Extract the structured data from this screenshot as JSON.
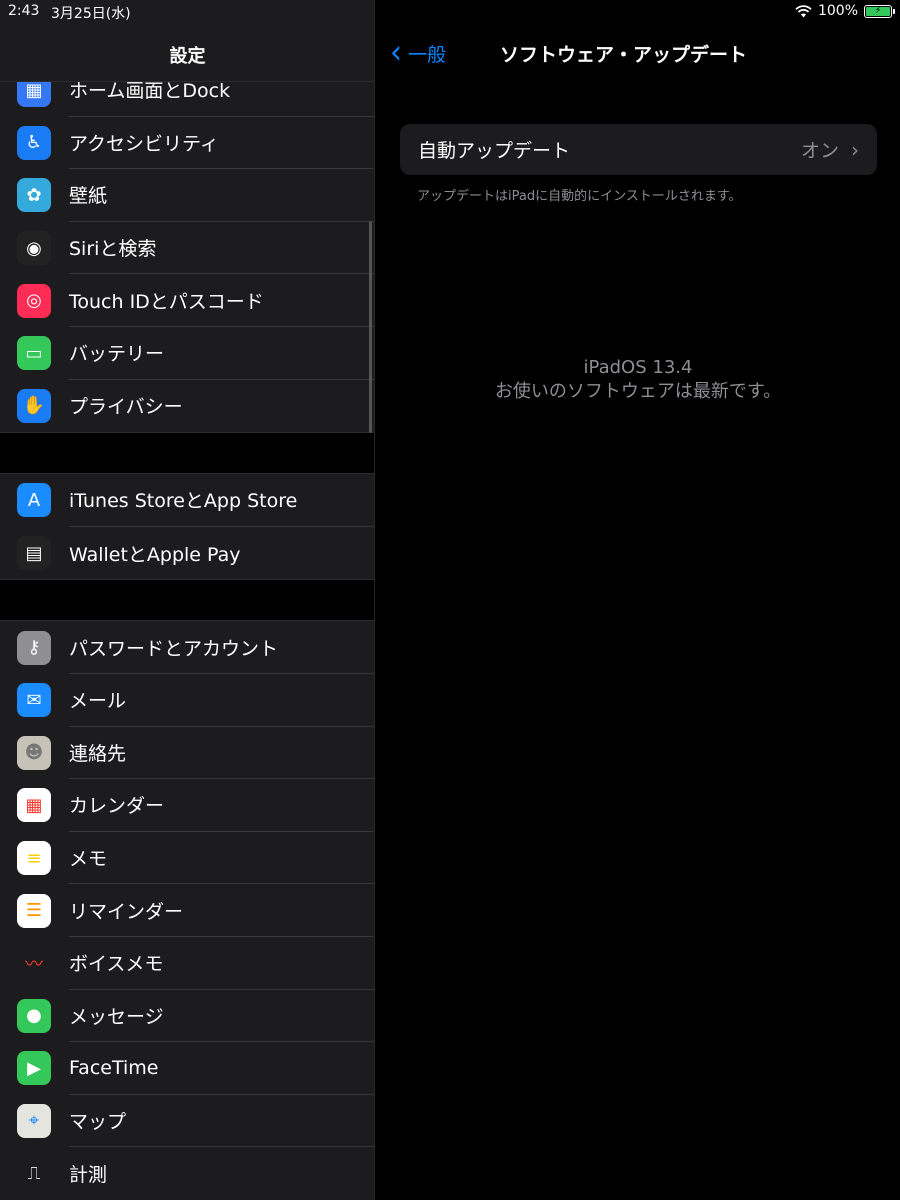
{
  "status": {
    "time": "2:43",
    "date": "3月25日(水)",
    "battery": "100%"
  },
  "sidebar": {
    "title": "設定",
    "groups": [
      [
        {
          "label": "ホーム画面とDock",
          "icon": "home-screen-icon",
          "color": "#3478f6"
        },
        {
          "label": "アクセシビリティ",
          "icon": "accessibility-icon",
          "color": "#1a7cf5"
        },
        {
          "label": "壁紙",
          "icon": "wallpaper-icon",
          "color": "#34aadc"
        },
        {
          "label": "Siriと検索",
          "icon": "siri-icon",
          "color": "#222"
        },
        {
          "label": "Touch IDとパスコード",
          "icon": "touch-id-icon",
          "color": "#ff2d55"
        },
        {
          "label": "バッテリー",
          "icon": "battery-icon",
          "color": "#34c759"
        },
        {
          "label": "プライバシー",
          "icon": "privacy-hand-icon",
          "color": "#1a7cf5"
        }
      ],
      [
        {
          "label": "iTunes StoreとApp Store",
          "icon": "app-store-icon",
          "color": "#1a8cff"
        },
        {
          "label": "WalletとApple Pay",
          "icon": "wallet-icon",
          "color": "#222"
        }
      ],
      [
        {
          "label": "パスワードとアカウント",
          "icon": "key-icon",
          "color": "#8e8e93"
        },
        {
          "label": "メール",
          "icon": "mail-icon",
          "color": "#1a8cff"
        },
        {
          "label": "連絡先",
          "icon": "contacts-icon",
          "color": "#c7c2b8"
        },
        {
          "label": "カレンダー",
          "icon": "calendar-icon",
          "color": "#ffffff"
        },
        {
          "label": "メモ",
          "icon": "notes-icon",
          "color": "#ffffff"
        },
        {
          "label": "リマインダー",
          "icon": "reminders-icon",
          "color": "#ffffff"
        },
        {
          "label": "ボイスメモ",
          "icon": "voice-memo-icon",
          "color": "#1c1c1e"
        },
        {
          "label": "メッセージ",
          "icon": "messages-icon",
          "color": "#34c759"
        },
        {
          "label": "FaceTime",
          "icon": "facetime-icon",
          "color": "#34c759"
        },
        {
          "label": "マップ",
          "icon": "maps-icon",
          "color": "#e5e5e0"
        },
        {
          "label": "計測",
          "icon": "measure-icon",
          "color": "#1c1c1e"
        }
      ]
    ]
  },
  "main": {
    "back_label": "一般",
    "title": "ソフトウェア・アップデート",
    "auto_update_label": "自動アップデート",
    "auto_update_value": "オン",
    "footnote": "アップデートはiPadに自動的にインストールされます。",
    "os_version": "iPadOS 13.4",
    "up_to_date": "お使いのソフトウェアは最新です。"
  }
}
